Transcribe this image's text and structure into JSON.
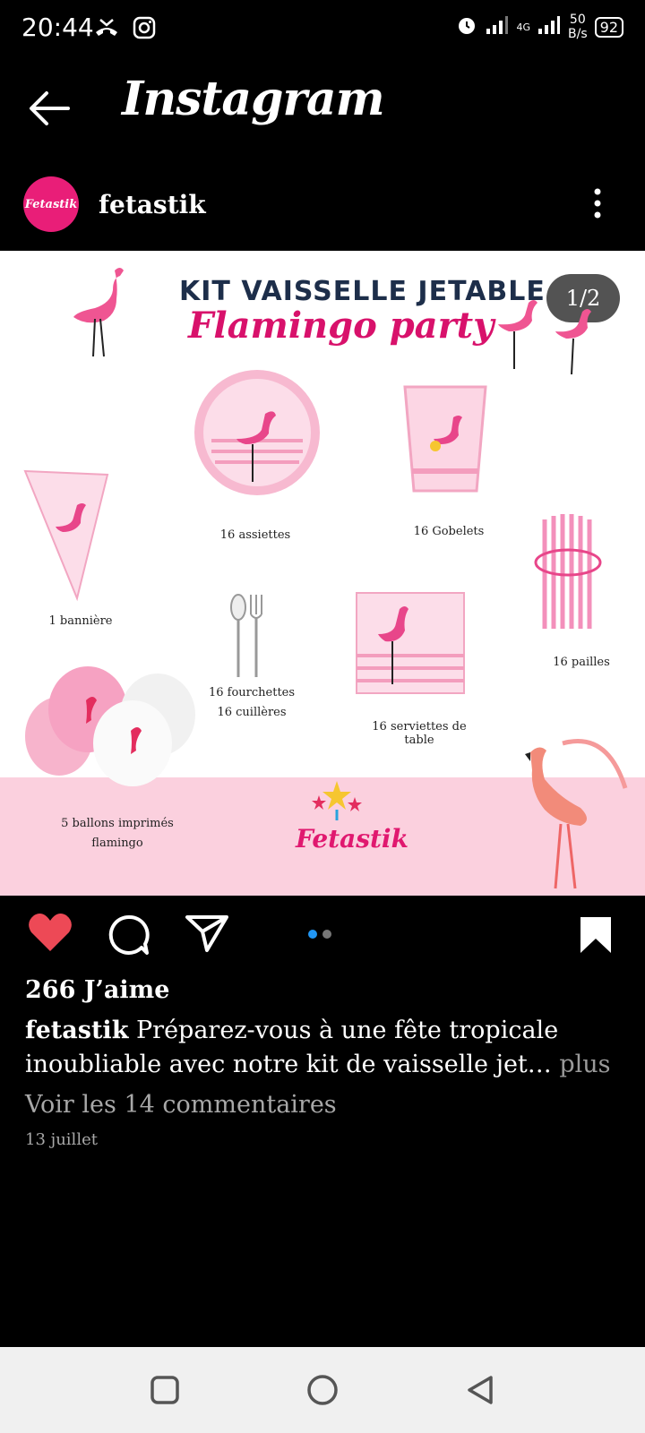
{
  "status_bar": {
    "time": "20:44",
    "network": "4G",
    "speed_value": "50",
    "speed_unit": "B/s",
    "battery": "92"
  },
  "top_bar": {
    "title": "Instagram"
  },
  "post": {
    "username": "fetastik",
    "avatar_text": "Fetastik",
    "image_counter": "1/2",
    "image": {
      "title_line1": "KIT VAISSELLE JETABLE",
      "title_line2": "Flamingo party",
      "items": [
        "16 assiettes",
        "16 Gobelets",
        "1 bannière",
        "16 pailles",
        "16 fourchettes",
        "16 cuillères",
        "16 serviettes de table",
        "5 ballons imprimés",
        "flamingo"
      ],
      "brand": "Fetastik"
    },
    "likes": "266 J’aime",
    "caption_user": "fetastik",
    "caption_text": "Préparez-vous à une fête tropicale inoubliable avec notre kit de vaisselle jet…",
    "caption_more": "plus",
    "view_comments": "Voir les 14 commentaires",
    "date": "13 juillet",
    "carousel": {
      "count": 2,
      "active": 0
    }
  }
}
